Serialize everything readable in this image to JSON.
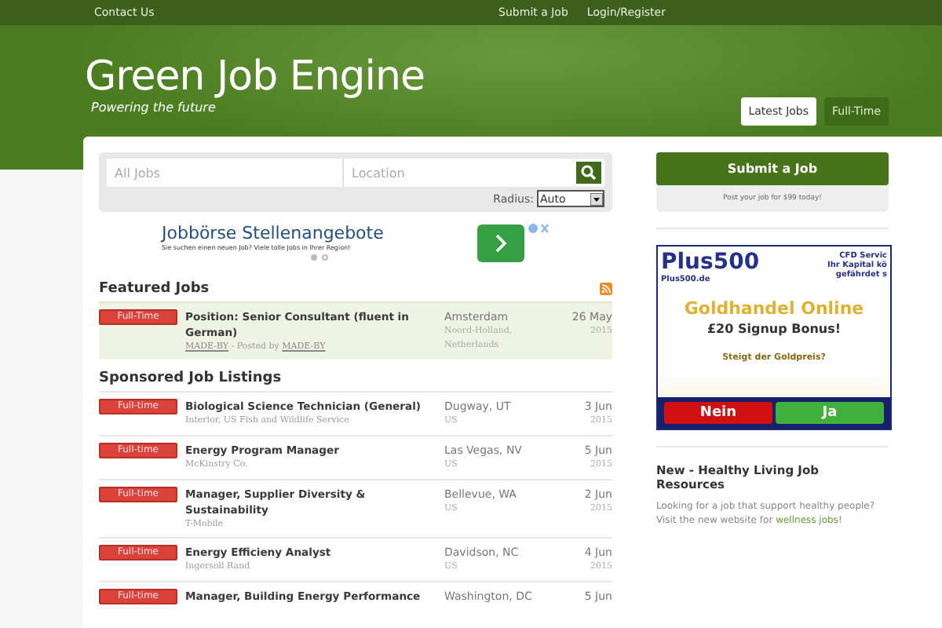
{
  "topbar": {
    "left_links": [
      "Contact Us"
    ],
    "right_links": [
      "Submit a Job",
      "Login/Register"
    ]
  },
  "header": {
    "logo": "Green Job Engine",
    "tagline": "Powering the future",
    "tabs": [
      {
        "label": "Latest Jobs",
        "selected": true
      },
      {
        "label": "Full-Time",
        "selected": false
      }
    ]
  },
  "search": {
    "keywords_placeholder": "All Jobs",
    "location_placeholder": "Location",
    "radius_label": "Radius:",
    "radius_value": "Auto"
  },
  "ad_banner": {
    "title": "Jobbörse Stellenangebote",
    "text": "Sie suchen einen neuen Job? Viele tolle Jobs in Ihrer Region!",
    "dots": [
      {
        "selected": true
      },
      {
        "selected": false
      }
    ]
  },
  "featured": {
    "heading": "Featured Jobs",
    "jobs": [
      {
        "type": "Full-Time",
        "title": "Position: Senior Consultant (fluent in German)",
        "company": "MADE-BY",
        "posted_by_label": "- Posted by",
        "posted_by": "MADE-BY",
        "city": "Amsterdam",
        "region": "Noord-Holland, Netherlands",
        "day": "26 May",
        "year": "2015"
      }
    ]
  },
  "sponsored": {
    "heading": "Sponsored Job Listings",
    "jobs": [
      {
        "type": "Full-time",
        "title": "Biological Science Technician (General)",
        "company": "Interior, US Fish and Wildlife Service",
        "city": "Dugway, UT",
        "region": "US",
        "day": "3 Jun",
        "year": "2015"
      },
      {
        "type": "Full-time",
        "title": "Energy Program Manager",
        "company": "McKinstry Co.",
        "city": "Las Vegas, NV",
        "region": "US",
        "day": "5 Jun",
        "year": "2015"
      },
      {
        "type": "Full-time",
        "title": "Manager, Supplier Diversity & Sustainability",
        "company": "T-Mobile",
        "city": "Bellevue, WA",
        "region": "US",
        "day": "2 Jun",
        "year": "2015"
      },
      {
        "type": "Full-time",
        "title": "Energy Efficieny Analyst",
        "company": "Ingersoll Rand",
        "city": "Davidson, NC",
        "region": "US",
        "day": "4 Jun",
        "year": "2015"
      },
      {
        "type": "Full-time",
        "title": "Manager, Building Energy Performance",
        "city": "Washington, DC",
        "day": "5 Jun"
      }
    ]
  },
  "sidebar": {
    "submit_button": "Submit a Job",
    "submit_note": "Post your job for $99 today!",
    "ad": {
      "brand": "Plus500",
      "site": "Plus500.de",
      "corner_lines": [
        "CFD Servic",
        "Ihr Kapital kö",
        "gefährdet s"
      ],
      "headline": "Goldhandel Online",
      "bonus": "£20 Signup Bonus!",
      "question": "Steigt der Goldpreis?",
      "buttons": [
        "Nein",
        "Ja"
      ]
    },
    "resource": {
      "heading": "New - Healthy Living Job Resources",
      "text": "Looking for a job that support healthy people? Visit the new website for",
      "link": "wellness jobs",
      "after": "!"
    }
  }
}
